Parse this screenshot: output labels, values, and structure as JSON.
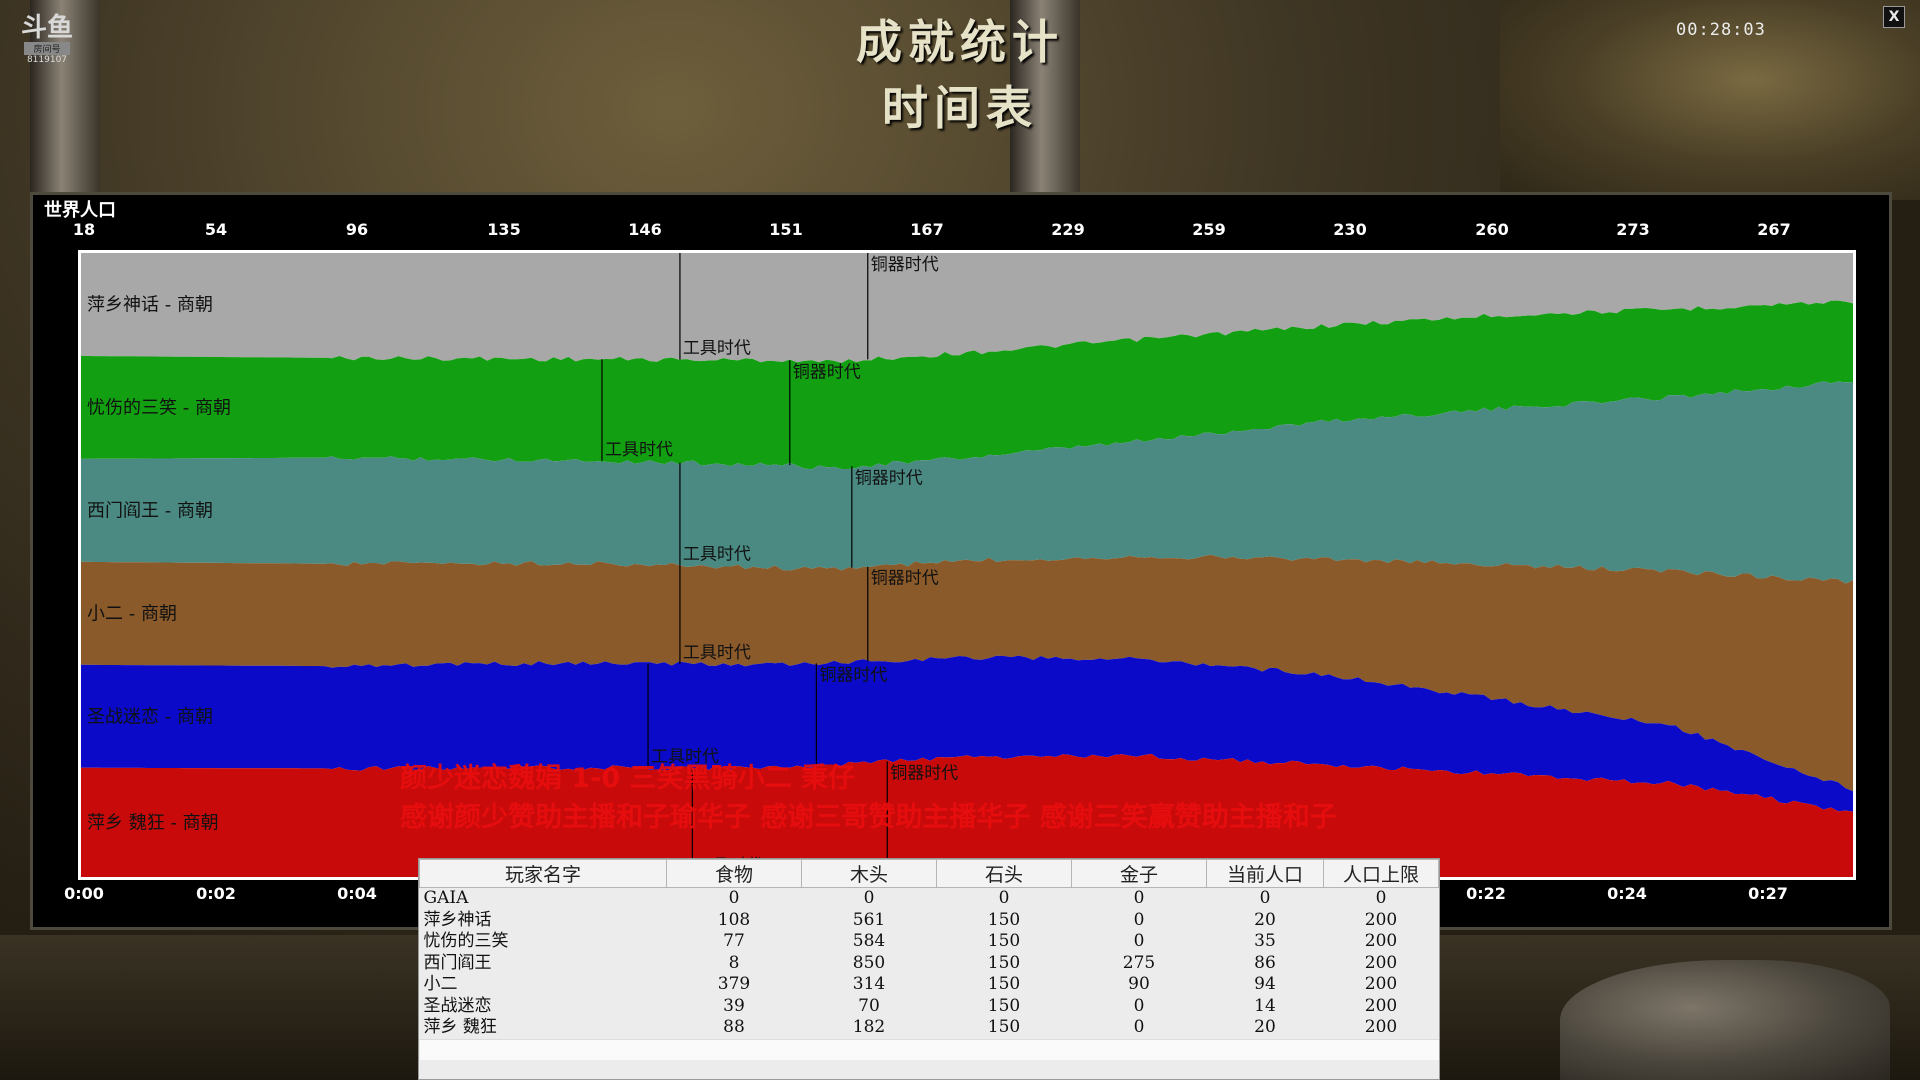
{
  "window": {
    "title_main": "成就统计",
    "title_sub": "时间表",
    "clock": "00:28:03",
    "close_label": "X"
  },
  "logo": {
    "mark": "斗鱼",
    "sub": "房间号",
    "number": "8119107"
  },
  "panel_label": "世界人口",
  "top_axis": [
    "18",
    "54",
    "96",
    "135",
    "146",
    "151",
    "167",
    "229",
    "259",
    "230",
    "260",
    "273",
    "267"
  ],
  "bottom_axis": [
    "0:00",
    "0:02",
    "0:04",
    "0:22",
    "0:24",
    "0:27"
  ],
  "chart_data": {
    "type": "area",
    "stacked": true,
    "normalized": true,
    "x": [
      0,
      14,
      28,
      40,
      42,
      50,
      60,
      70,
      80,
      90,
      100
    ],
    "series": [
      {
        "name": "萍乡神话 - 商朝",
        "color": "#a8a8a8",
        "values": [
          16.5,
          16.8,
          17.0,
          17.2,
          17.5,
          16.0,
          13.8,
          11.7,
          10.0,
          9.0,
          7.7
        ]
      },
      {
        "name": "忧伤的三笑 - 商朝",
        "color": "#12a012",
        "values": [
          16.5,
          16.0,
          16.2,
          16.8,
          17.0,
          16.8,
          16.3,
          15.3,
          15.0,
          14.0,
          12.8
        ]
      },
      {
        "name": "西门阎王 - 商朝",
        "color": "#4a8a82",
        "values": [
          16.5,
          17.0,
          16.5,
          16.5,
          16.2,
          16.5,
          18.5,
          22.0,
          25.0,
          28.0,
          32.2
        ]
      },
      {
        "name": "小二 - 商朝",
        "color": "#8a5a2a",
        "values": [
          16.5,
          16.4,
          16.0,
          15.5,
          15.0,
          15.5,
          16.5,
          18.5,
          21.5,
          25.0,
          33.3
        ]
      },
      {
        "name": "圣战迷恋 - 商朝",
        "color": "#0a0ac8",
        "values": [
          16.5,
          16.4,
          16.8,
          16.5,
          16.3,
          16.0,
          15.5,
          14.5,
          12.0,
          9.0,
          3.6
        ]
      },
      {
        "name": "萍乡 魏狂 - 商朝",
        "color": "#c80a0a",
        "values": [
          17.5,
          17.4,
          17.5,
          17.5,
          18.0,
          19.2,
          19.4,
          18.0,
          16.5,
          15.0,
          10.4
        ]
      }
    ],
    "age_markers": [
      {
        "series": 0,
        "x": 33.8,
        "label": "工具时代"
      },
      {
        "series": 0,
        "x": 44.4,
        "label": "铜器时代"
      },
      {
        "series": 1,
        "x": 29.4,
        "label": "工具时代"
      },
      {
        "series": 1,
        "x": 40.0,
        "label": "铜器时代"
      },
      {
        "series": 2,
        "x": 33.8,
        "label": "工具时代"
      },
      {
        "series": 2,
        "x": 43.5,
        "label": "铜器时代"
      },
      {
        "series": 3,
        "x": 33.8,
        "label": "工具时代"
      },
      {
        "series": 3,
        "x": 44.4,
        "label": "铜器时代"
      },
      {
        "series": 4,
        "x": 32.0,
        "label": "工具时代"
      },
      {
        "series": 4,
        "x": 41.5,
        "label": "铜器时代"
      },
      {
        "series": 5,
        "x": 34.5,
        "label": "工具时代"
      },
      {
        "series": 5,
        "x": 45.5,
        "label": "铜器时代"
      }
    ]
  },
  "overlay": {
    "line1": "颜少迷恋魏娟 1-0 三笑黑骑小二 秉仔",
    "line2": "感谢颜少赞助主播和子瑜华子  感谢三哥赞助主播华子  感谢三笑赢赞助主播和子"
  },
  "stats_table": {
    "headers": [
      "玩家名字",
      "食物",
      "木头",
      "石头",
      "金子",
      "当前人口",
      "人口上限"
    ],
    "rows": [
      [
        "GAIA",
        "0",
        "0",
        "0",
        "0",
        "0",
        "0"
      ],
      [
        "萍乡神话",
        "108",
        "561",
        "150",
        "0",
        "20",
        "200"
      ],
      [
        "忧伤的三笑",
        "77",
        "584",
        "150",
        "0",
        "35",
        "200"
      ],
      [
        "西门阎王",
        "8",
        "850",
        "150",
        "275",
        "86",
        "200"
      ],
      [
        "小二",
        "379",
        "314",
        "150",
        "90",
        "94",
        "200"
      ],
      [
        "圣战迷恋",
        "39",
        "70",
        "150",
        "0",
        "14",
        "200"
      ],
      [
        "萍乡 魏狂",
        "88",
        "182",
        "150",
        "0",
        "20",
        "200"
      ]
    ]
  },
  "colors": {
    "panel_bg": "#000000",
    "overlay_red": "#e80e0e"
  }
}
